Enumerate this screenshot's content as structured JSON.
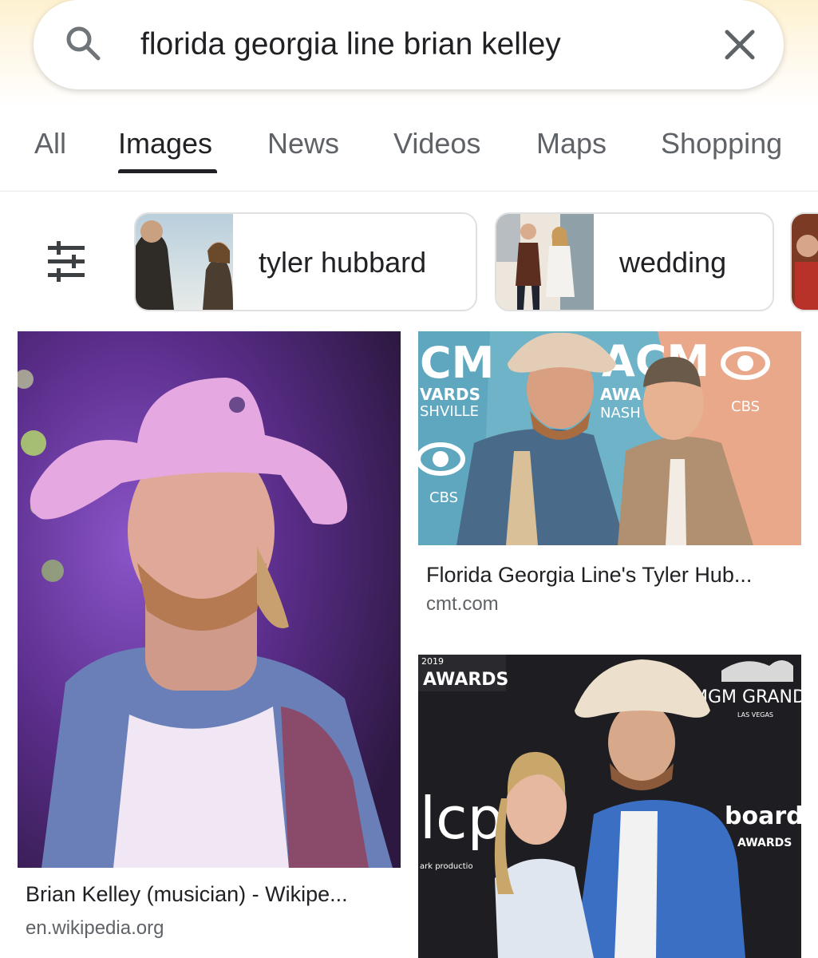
{
  "search": {
    "query": "florida georgia line brian kelley"
  },
  "tabs": [
    {
      "label": "All"
    },
    {
      "label": "Images"
    },
    {
      "label": "News"
    },
    {
      "label": "Videos"
    },
    {
      "label": "Maps"
    },
    {
      "label": "Shopping"
    }
  ],
  "active_tab": "Images",
  "chips": [
    {
      "label": "tyler hubbard"
    },
    {
      "label": "wedding"
    }
  ],
  "results": [
    {
      "title": "Brian Kelley (musician) - Wikipe...",
      "source": "en.wikipedia.org"
    },
    {
      "title": "Florida Georgia Line's Tyler Hub...",
      "source": "cmt.com"
    }
  ],
  "image_overlays": {
    "acm_left": "CM",
    "acm_awards": "VARDS",
    "acm_nashville": "SHVILLE",
    "acm_right": "ACM",
    "acm_awa": "AWA",
    "acm_nash": "NASH",
    "cbs": "CBS",
    "cbs_left": "CBS",
    "awards_banner": "AWARDS",
    "awards_year": "2019",
    "mgm_grand": "MGM GRAND",
    "las_vegas": "LAS VEGAS",
    "bcp": "lcp",
    "billboard": "board",
    "billboard_awards": "AWARDS",
    "production": "ark productio"
  },
  "icons": {
    "search": "search-icon",
    "clear": "close-icon",
    "filter": "tune-icon"
  }
}
